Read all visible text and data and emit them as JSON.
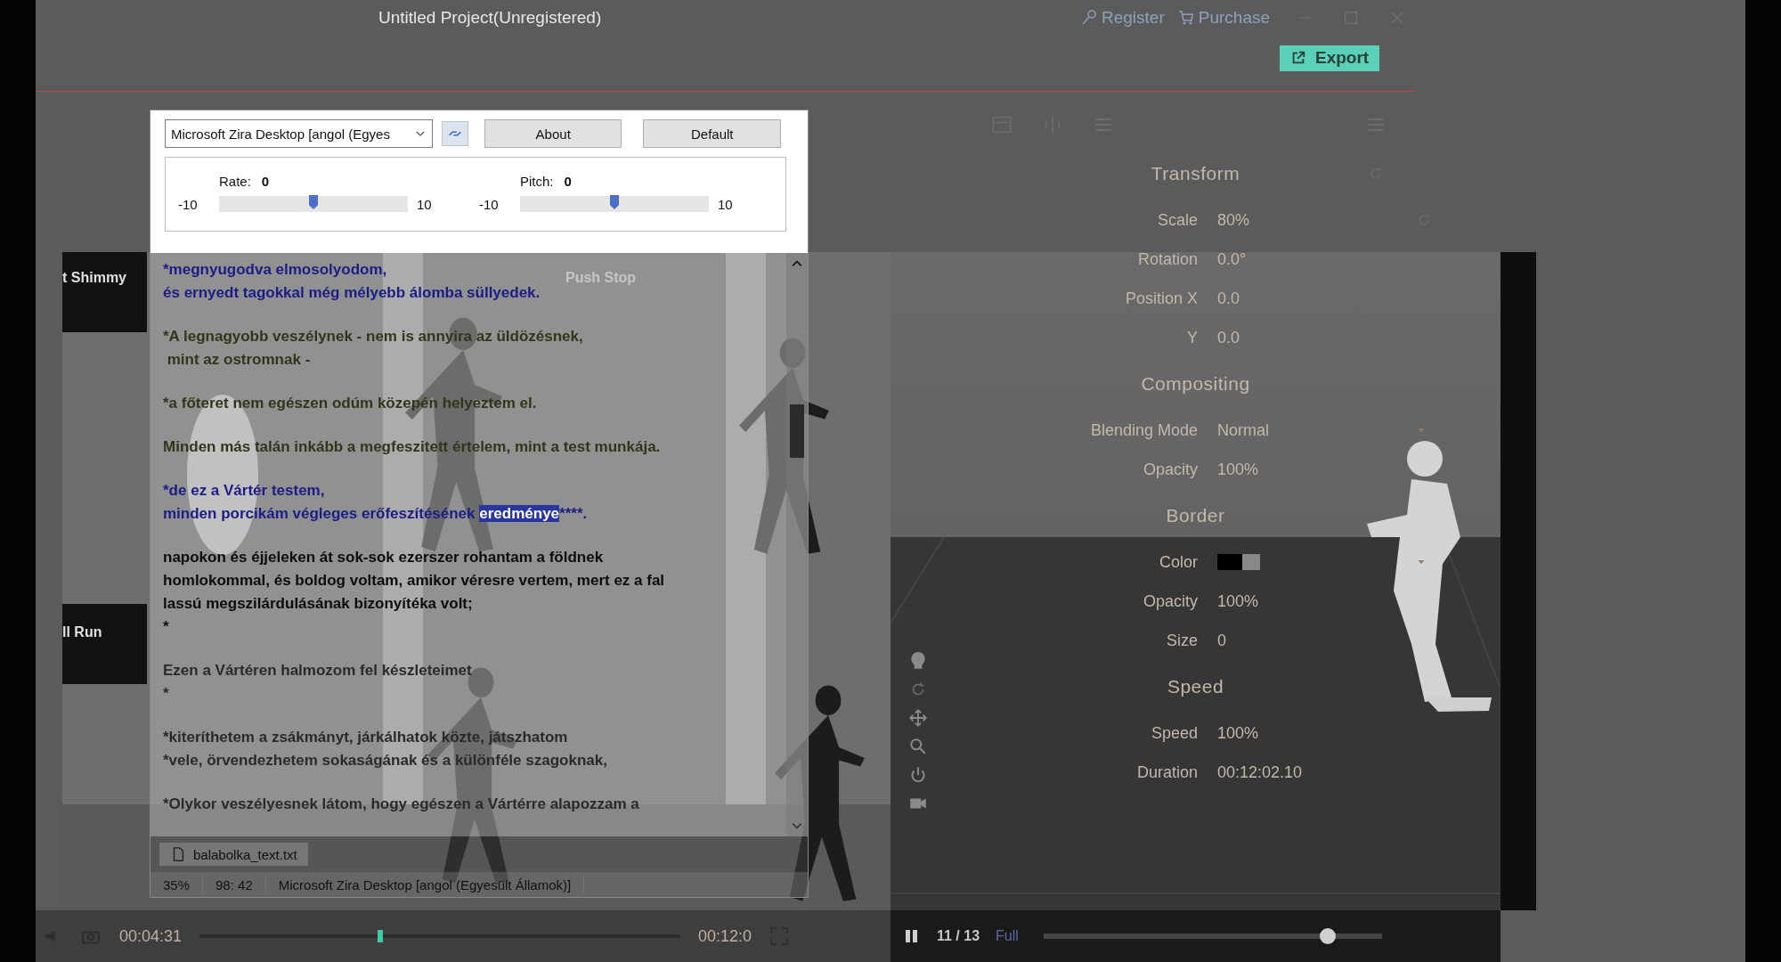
{
  "window": {
    "title": "Untitled Project(Unregistered)",
    "actions": [
      {
        "kind": "register",
        "label": "Register"
      },
      {
        "kind": "purchase",
        "label": "Purchase"
      }
    ],
    "export_button": "Export"
  },
  "library": {
    "labels": [
      "t Shimmy",
      "Push Stop",
      "ll Run"
    ]
  },
  "balabolka": {
    "voice": "Microsoft Zira Desktop [angol (Egyes",
    "buttons": [
      "About",
      "Default"
    ],
    "sliders": [
      {
        "label": "Rate:",
        "value": "0",
        "min": "-10",
        "max": "10",
        "level": 0.5
      },
      {
        "label": "Pitch:",
        "value": "0",
        "min": "-10",
        "max": "10",
        "level": 0.5
      }
    ],
    "paragraphs": [
      {
        "color": "#1c1c86",
        "lines": [
          {
            "text": "*megnyugodva elmosolyodom,"
          },
          {
            "text": "és ernyedt tagokkal még mélyebb álomba süllyedek."
          }
        ]
      },
      {
        "color": "#33351a",
        "lines": [
          {
            "text": "*A legnagyobb veszélynek - nem is annyira az üldözésnek,"
          },
          {
            "text": " mint az ostromnak -"
          }
        ]
      },
      {
        "color": "#33351a",
        "lines": [
          {
            "text": "*a főteret nem egészen odúm közepén helyeztem el."
          }
        ]
      },
      {
        "color": "#33351a",
        "lines": [
          {
            "text": "Minden más talán inkább a megfeszitett értelem, mint a test munkája."
          }
        ]
      },
      {
        "color": "#1c1c86",
        "lines": [
          {
            "text": "*de ez a Vártér testem,"
          },
          {
            "text": "minden porcikám végleges erőfeszítésének ",
            "selected_text": "eredménye",
            "after": "****."
          }
        ]
      },
      {
        "color": "#0c0c0c",
        "lines": [
          {
            "text": "napokon és éjjeleken át sok-sok ezerszer rohantam a földnek"
          },
          {
            "text": "homlokommal, és boldog voltam, amikor véresre vertem, mert ez a fal"
          },
          {
            "text": "lassú megszilárdulásának bizonyítéka volt;"
          },
          {
            "text": "*"
          }
        ]
      },
      {
        "color": "#2a2a2a",
        "lines": [
          {
            "text": "Ezen a Vártéren halmozom fel készleteimet"
          },
          {
            "text": "*"
          }
        ]
      },
      {
        "color": "#2a2a2a",
        "lines": [
          {
            "text": "*kiteríthetem a zsákmányt, járkálhatok közte, játszhatom"
          },
          {
            "text": "*vele, örvendezhetem sokaságának és a különféle szagoknak,"
          }
        ]
      },
      {
        "color": "#2a2a2a",
        "lines": [
          {
            "text": "*Olykor veszélyesnek látom, hogy egészen a Vártérre alapozzam a"
          }
        ]
      }
    ],
    "file_tab": "balabolka_text.txt",
    "status": [
      "35%",
      "98:  42",
      "Microsoft Zira Desktop [angol (Egyesült Államok)]"
    ]
  },
  "properties": {
    "sections": [
      {
        "title": "Transform",
        "kind": "resettable",
        "rows": [
          {
            "label": "Scale",
            "value": "80%",
            "kind": "resettable"
          },
          {
            "label": "Rotation",
            "value": "0.0°",
            "kind": "plain"
          },
          {
            "label": "Position  X",
            "value": "0.0",
            "kind": "plain"
          },
          {
            "label": "Y",
            "value": "0.0",
            "kind": "plain"
          }
        ]
      },
      {
        "title": "Compositing",
        "kind": "plain",
        "rows": [
          {
            "label": "Blending Mode",
            "value": "Normal",
            "kind": "dropdown"
          },
          {
            "label": "Opacity",
            "value": "100%",
            "kind": "plain"
          }
        ]
      },
      {
        "title": "Border",
        "kind": "plain",
        "rows": [
          {
            "label": "Color",
            "kind": "color",
            "color": "#000000"
          },
          {
            "label": "Opacity",
            "value": "100%",
            "kind": "plain"
          },
          {
            "label": "Size",
            "value": "0",
            "kind": "plain"
          }
        ]
      },
      {
        "title": "Speed",
        "kind": "plain",
        "rows": [
          {
            "label": "Speed",
            "value": "100%",
            "kind": "plain"
          },
          {
            "label": "Duration",
            "value": "00:12:02.10",
            "kind": "plain"
          }
        ]
      }
    ]
  },
  "player": {
    "current_time": "00:04:31",
    "total_time": "00:12:0",
    "progress": {
      "level": 0.375
    },
    "counter": "11 / 13",
    "mode": "Full",
    "zoom": {
      "level": 0.84
    }
  }
}
